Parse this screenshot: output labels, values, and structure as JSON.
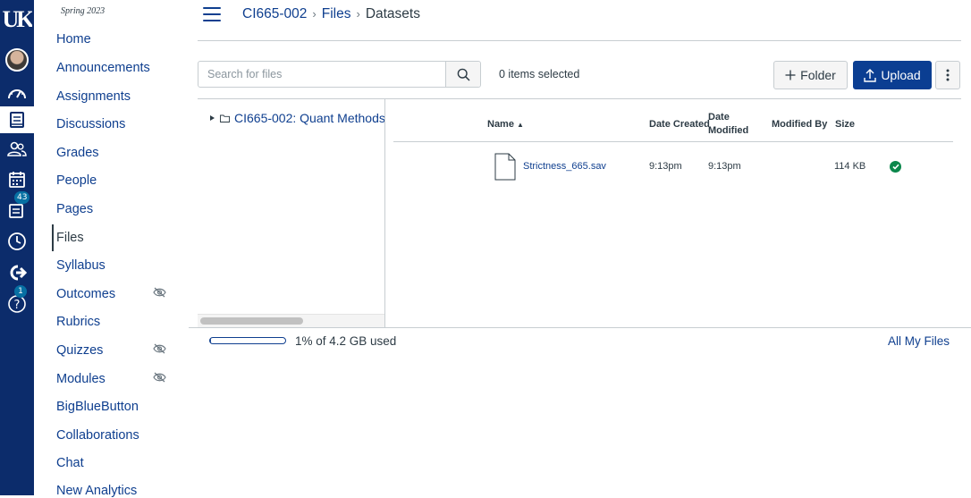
{
  "global_nav": {
    "logo_text": "UK",
    "items": [
      {
        "name": "account",
        "icon": "avatar"
      },
      {
        "name": "dashboard",
        "icon": "dashboard-icon"
      },
      {
        "name": "courses",
        "icon": "courses-icon"
      },
      {
        "name": "groups",
        "icon": "groups-icon"
      },
      {
        "name": "calendar",
        "icon": "calendar-icon"
      },
      {
        "name": "inbox",
        "icon": "inbox-icon",
        "badge": "43"
      },
      {
        "name": "history",
        "icon": "history-icon"
      },
      {
        "name": "commons",
        "icon": "commons-icon"
      },
      {
        "name": "help",
        "icon": "help-icon",
        "badge": "1"
      }
    ]
  },
  "course_nav": {
    "term": "Spring 2023",
    "items": [
      {
        "label": "Home"
      },
      {
        "label": "Announcements"
      },
      {
        "label": "Assignments"
      },
      {
        "label": "Discussions"
      },
      {
        "label": "Grades"
      },
      {
        "label": "People"
      },
      {
        "label": "Pages"
      },
      {
        "label": "Files",
        "active": true
      },
      {
        "label": "Syllabus"
      },
      {
        "label": "Outcomes",
        "hidden_from_students": true
      },
      {
        "label": "Rubrics"
      },
      {
        "label": "Quizzes",
        "hidden_from_students": true
      },
      {
        "label": "Modules",
        "hidden_from_students": true
      },
      {
        "label": "BigBlueButton"
      },
      {
        "label": "Collaborations"
      },
      {
        "label": "Chat"
      },
      {
        "label": "New Analytics"
      }
    ]
  },
  "breadcrumb": {
    "course": "CI665-002",
    "section": "Files",
    "current": "Datasets"
  },
  "toolbar": {
    "search_placeholder": "Search for files",
    "selected_count": "0 items selected",
    "folder_label": "Folder",
    "upload_label": "Upload"
  },
  "folder_tree": {
    "root": "CI665-002: Quant Methods"
  },
  "file_table": {
    "columns": {
      "name": "Name",
      "date_created": "Date Created",
      "date_modified_line1": "Date",
      "date_modified_line2": "Modified",
      "modified_by": "Modified By",
      "size": "Size"
    },
    "sort_indicator": "▲",
    "rows": [
      {
        "name": "Strictness_665.sav",
        "date_created": "9:13pm",
        "date_modified": "9:13pm",
        "modified_by": "",
        "size": "114 KB",
        "published": true
      }
    ]
  },
  "footer": {
    "quota_text": "1% of 4.2 GB used",
    "quota_percent": 1,
    "all_files_link": "All My Files"
  },
  "colors": {
    "nav_bg": "#0c2c6b",
    "link": "#0f3f8f",
    "upload_bg": "#0b3e92",
    "published": "#0b874b",
    "badge": "#0770a3"
  }
}
